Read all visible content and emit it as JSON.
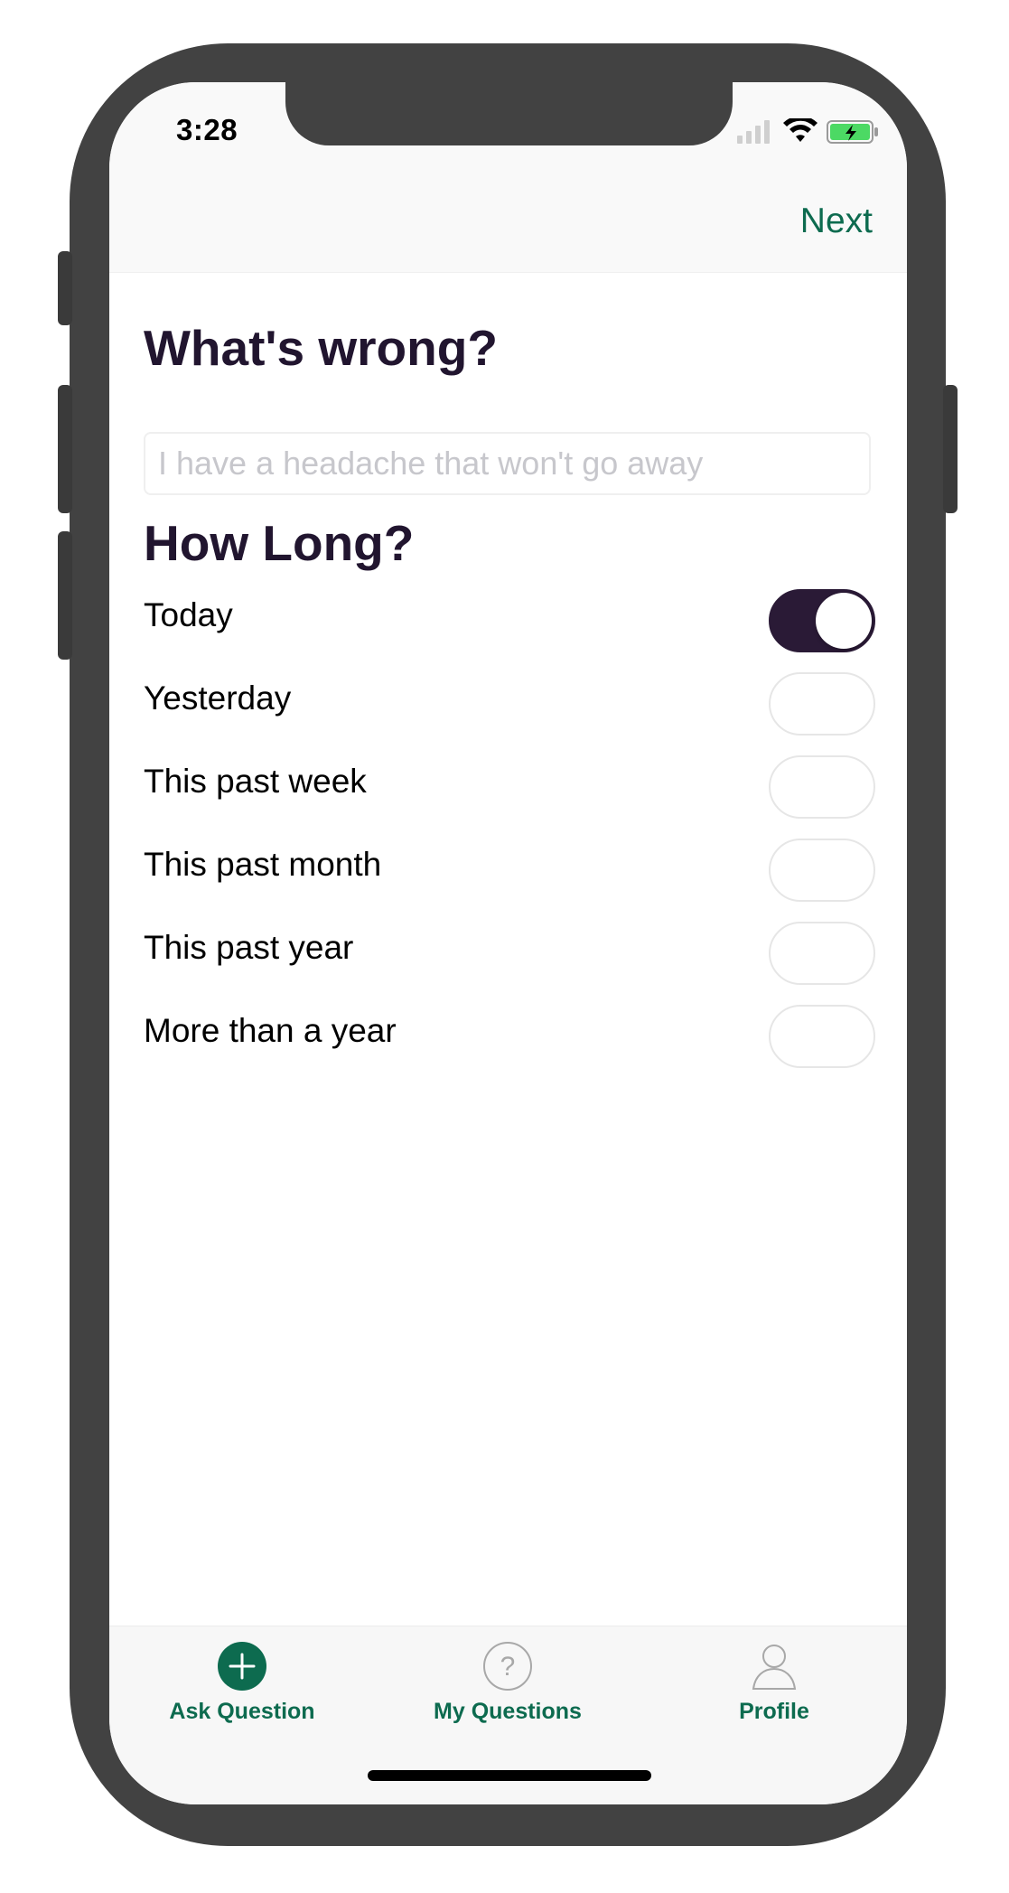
{
  "status_bar": {
    "time": "3:28"
  },
  "nav": {
    "next_label": "Next"
  },
  "form": {
    "question_title": "What's wrong?",
    "input_placeholder": "I have a headache that won't go away",
    "input_value": "",
    "duration_title": "How Long?",
    "options": [
      {
        "label": "Today",
        "selected": true
      },
      {
        "label": "Yesterday",
        "selected": false
      },
      {
        "label": "This past week",
        "selected": false
      },
      {
        "label": "This past month",
        "selected": false
      },
      {
        "label": "This past year",
        "selected": false
      },
      {
        "label": "More than a year",
        "selected": false
      }
    ]
  },
  "tabs": [
    {
      "label": "Ask Question",
      "icon": "plus-circle-icon",
      "active": true
    },
    {
      "label": "My Questions",
      "icon": "question-circle-icon",
      "active": false
    },
    {
      "label": "Profile",
      "icon": "person-icon",
      "active": false
    }
  ],
  "colors": {
    "accent_green": "#0d6b4f",
    "heading_dark": "#21152f",
    "toggle_on": "#2a1a36",
    "phone_frame": "#424242"
  }
}
